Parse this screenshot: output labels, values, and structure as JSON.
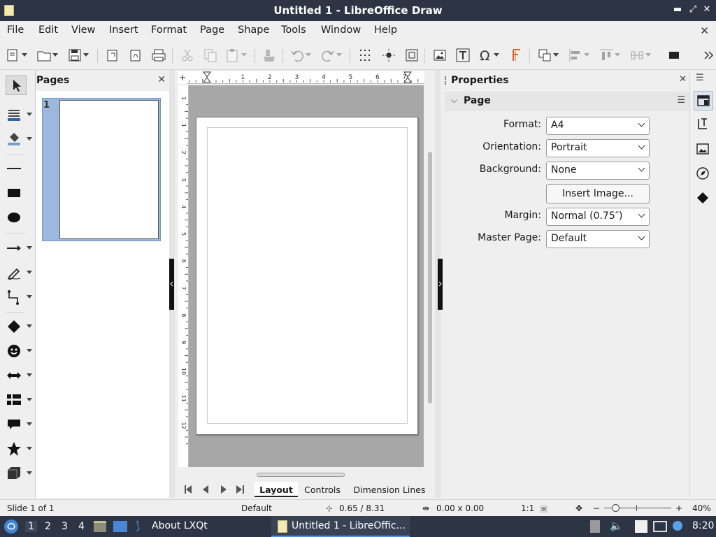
{
  "window": {
    "title": "Untitled 1 - LibreOffice Draw"
  },
  "menubar": {
    "items": [
      "File",
      "Edit",
      "View",
      "Insert",
      "Format",
      "Page",
      "Shape",
      "Tools",
      "Window",
      "Help"
    ]
  },
  "pages_panel": {
    "title": "Pages",
    "thumbnails": [
      {
        "number": "1"
      }
    ]
  },
  "canvas": {
    "ruler_h": [
      "1",
      "2",
      "3",
      "4",
      "5",
      "6",
      "7",
      "8"
    ],
    "ruler_v": [
      "1",
      "1",
      "2",
      "3",
      "4",
      "5",
      "6",
      "7",
      "8",
      "9",
      "10",
      "11",
      "12"
    ],
    "tabs": [
      "Layout",
      "Controls",
      "Dimension Lines"
    ],
    "active_tab": "Layout"
  },
  "properties": {
    "title": "Properties",
    "section": "Page",
    "format_label": "Format:",
    "format_value": "A4",
    "orientation_label": "Orientation:",
    "orientation_value": "Portrait",
    "background_label": "Background:",
    "background_value": "None",
    "insert_image_label": "Insert Image...",
    "margin_label": "Margin:",
    "margin_value": "Normal (0.75″)",
    "master_label": "Master Page:",
    "master_value": "Default"
  },
  "statusbar": {
    "slide": "Slide 1 of 1",
    "master": "Default",
    "position": "0.65 / 8.31",
    "size": "0.00 x 0.00",
    "scale": "1:1",
    "zoom": "40%"
  },
  "taskbar": {
    "workspaces": [
      "1",
      "2",
      "3",
      "4"
    ],
    "about_task": "About LXQt",
    "active_task": "Untitled 1 - LibreOffic...",
    "clock": "8:20"
  },
  "colors": {
    "titlebar": "#2d3544",
    "selection": "#9cb9dd",
    "workspace": "#a7a7a7"
  }
}
